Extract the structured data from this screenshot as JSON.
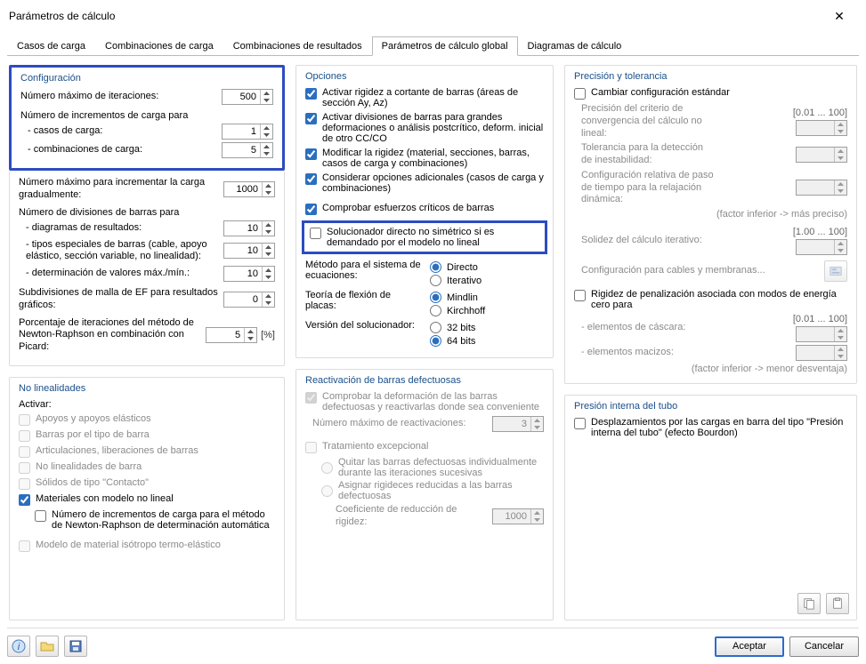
{
  "window": {
    "title": "Parámetros de cálculo"
  },
  "tabs": {
    "t0": "Casos de carga",
    "t1": "Combinaciones de carga",
    "t2": "Combinaciones de resultados",
    "t3": "Parámetros de cálculo global",
    "t4": "Diagramas de cálculo"
  },
  "config": {
    "title": "Configuración",
    "max_iter_label": "Número máximo de iteraciones:",
    "max_iter": "500",
    "incr_header": "Número de incrementos de carga para",
    "incr_lc_label": "- casos de carga:",
    "incr_lc": "1",
    "incr_co_label": "- combinaciones de carga:",
    "incr_co": "5",
    "max_grad_label": "Número máximo para incrementar la carga gradualmente:",
    "max_grad": "1000",
    "div_header": "Número de divisiones de barras para",
    "div_diag_label": "- diagramas de resultados:",
    "div_diag": "10",
    "div_types_label": "- tipos especiales de barras (cable, apoyo elástico, sección variable, no linealidad):",
    "div_types": "10",
    "div_det_label": "- determinación de valores máx./mín.:",
    "div_det": "10",
    "fe_sub_label": "Subdivisiones de malla de EF para resultados gráficos:",
    "fe_sub": "0",
    "nr_picard_label": "Porcentaje de iteraciones del método de Newton-Raphson en combinación con Picard:",
    "nr_picard": "5",
    "nr_picard_unit": "[%]"
  },
  "options": {
    "title": "Opciones",
    "o1": "Activar rigidez a cortante de barras (áreas de sección Ay, Az)",
    "o2": "Activar divisiones de barras para grandes deformaciones o análisis postcrítico, deform. inicial de otro CC/CO",
    "o3": "Modificar la rigidez (material, secciones, barras, casos de carga y combinaciones)",
    "o4": "Considerar opciones adicionales (casos de carga y combinaciones)",
    "o5": "Comprobar esfuerzos críticos de barras",
    "o6": "Solucionador directo no simétrico si es demandado por el modelo no lineal",
    "eq_label": "Método para el sistema de ecuaciones:",
    "eq_direct": "Directo",
    "eq_iter": "Iterativo",
    "plate_label": "Teoría de flexión de placas:",
    "plate_mindlin": "Mindlin",
    "plate_kirch": "Kirchhoff",
    "ver_label": "Versión del solucionador:",
    "ver_32": "32 bits",
    "ver_64": "64 bits"
  },
  "precision": {
    "title": "Precisión y tolerancia",
    "change": "Cambiar configuración estándar",
    "p1_label": "Precisión del criterio de convergencia del cálculo no lineal:",
    "r1": "[0.01 ... 100]",
    "p2_label": "Tolerancia para la detección de inestabilidad:",
    "p3_label": "Configuración relativa de paso de tiempo para la relajación dinámica:",
    "hint1": "(factor inferior -> más preciso)",
    "p4_label": "Solidez del cálculo iterativo:",
    "r2": "[1.00 ... 100]",
    "cables": "Configuración para cables y membranas...",
    "pen_label": "Rigidez de penalización asociada con modos de energía cero para",
    "pen_shell": "- elementos de cáscara:",
    "pen_solid": "- elementos macizos:",
    "r3": "[0.01 ... 100]",
    "hint2": "(factor inferior -> menor desventaja)"
  },
  "nonlin": {
    "title": "No linealidades",
    "activate": "Activar:",
    "n1": "Apoyos y apoyos elásticos",
    "n2": "Barras por el tipo de barra",
    "n3": "Articulaciones, liberaciones de barras",
    "n4": "No linealidades de barra",
    "n5": "Sólidos de tipo \"Contacto\"",
    "n6": "Materiales con modelo no lineal",
    "n6a": "Número de incrementos de carga para el método de Newton-Raphson de determinación automática",
    "n7": "Modelo de material isótropo termo-elástico"
  },
  "react": {
    "title": "Reactivación de barras defectuosas",
    "r1": "Comprobar la deformación de las barras defectuosas y reactivarlas donde sea conveniente",
    "max_label": "Número máximo de reactivaciones:",
    "max_val": "3",
    "r2": "Tratamiento excepcional",
    "r2a": "Quitar las barras defectuosas individualmente durante las iteraciones sucesivas",
    "r2b": "Asignar rigideces reducidas a las barras defectuosas",
    "coef_label": "Coeficiente de reducción de rigidez:",
    "coef_val": "1000"
  },
  "tube": {
    "title": "Presión interna del tubo",
    "t1": "Desplazamientos por las cargas en barra del tipo \"Presión interna del tubo\" (efecto Bourdon)"
  },
  "footer": {
    "accept": "Aceptar",
    "cancel": "Cancelar"
  }
}
